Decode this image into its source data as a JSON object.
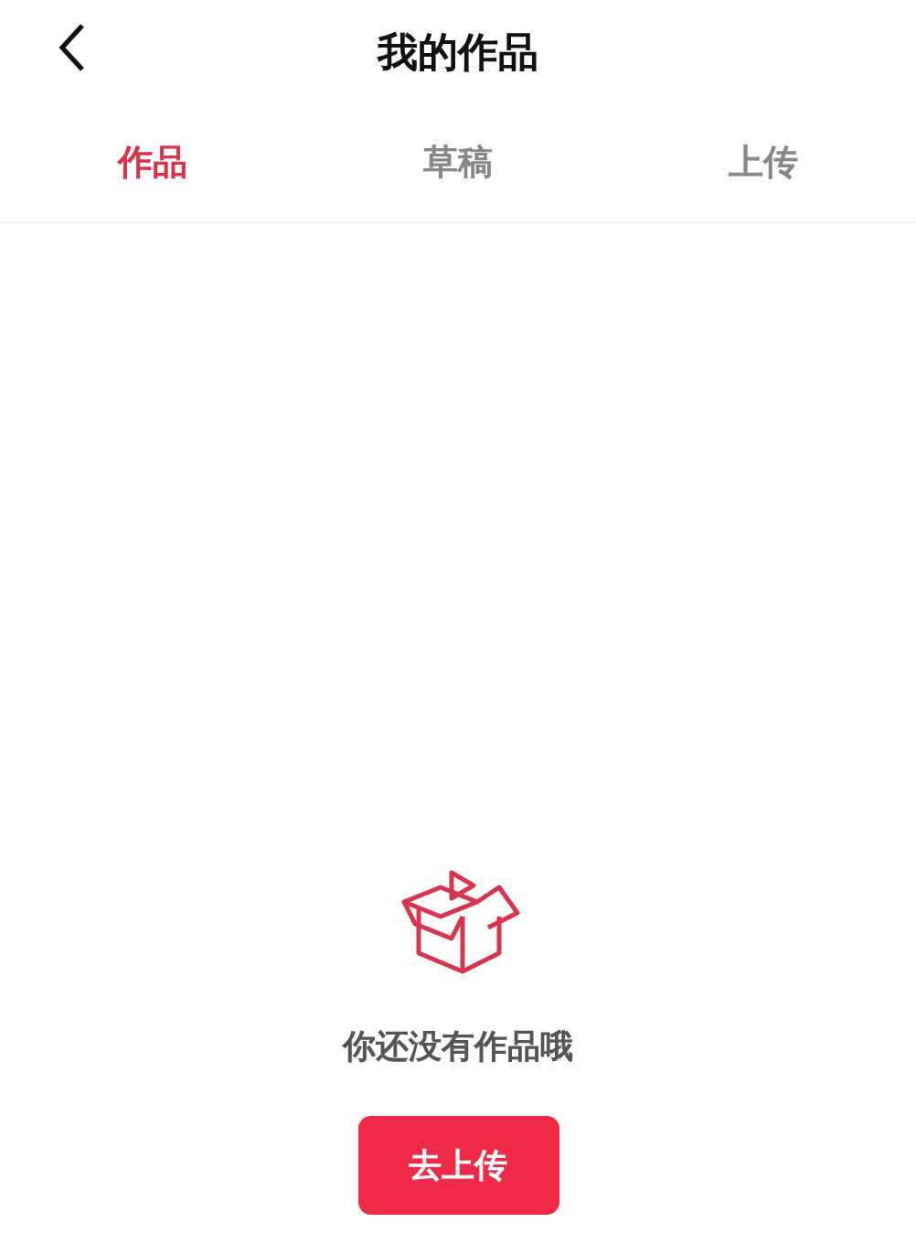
{
  "header": {
    "title": "我的作品"
  },
  "tabs": [
    {
      "label": "作品",
      "selected": true
    },
    {
      "label": "草稿",
      "selected": false
    },
    {
      "label": "上传",
      "selected": false
    }
  ],
  "empty_state": {
    "message": "你还没有作品哦",
    "button": "去上传"
  }
}
